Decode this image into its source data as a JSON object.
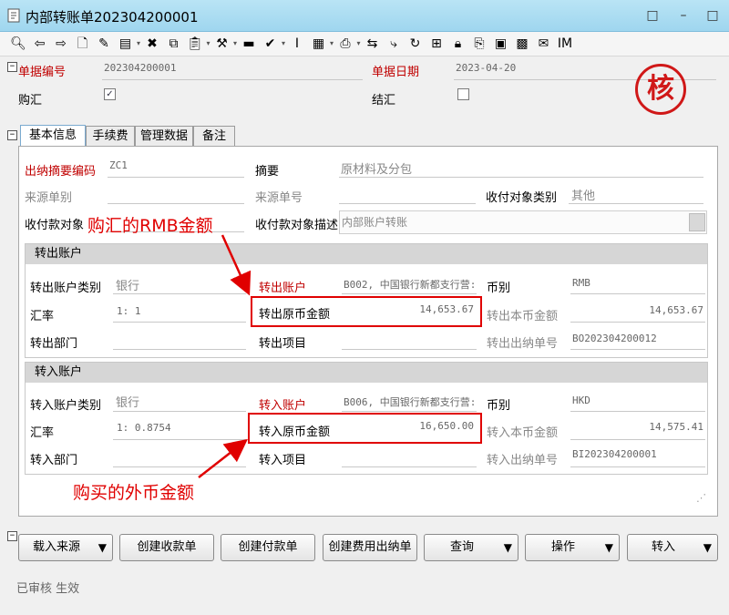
{
  "window": {
    "title": "内部转账单202304200001",
    "pin": "□",
    "minimize": "–",
    "maximize": "□",
    "close": "×"
  },
  "toolbar": [
    {
      "name": "preview-icon",
      "glyph": "🔍︎"
    },
    {
      "name": "arrow-left-icon",
      "glyph": "⇦"
    },
    {
      "name": "arrow-right-icon",
      "glyph": "⇨"
    },
    {
      "name": "new-document-icon",
      "glyph": "🗋"
    },
    {
      "name": "edit-icon",
      "glyph": "✎"
    },
    {
      "name": "save-icon",
      "glyph": "▤"
    },
    {
      "name": "delete-icon",
      "glyph": "✖"
    },
    {
      "name": "copy-icon",
      "glyph": "⧉"
    },
    {
      "name": "paste-icon",
      "glyph": "📋︎"
    },
    {
      "name": "tools-icon",
      "glyph": "⚒"
    },
    {
      "name": "red-doc-icon",
      "glyph": "▬"
    },
    {
      "name": "approve-icon",
      "glyph": "✔"
    },
    {
      "name": "unapprove-icon",
      "glyph": "Ⅰ"
    },
    {
      "name": "chart-icon",
      "glyph": "▦"
    },
    {
      "name": "print-icon",
      "glyph": "⎙"
    },
    {
      "name": "link-icon",
      "glyph": "⇆"
    },
    {
      "name": "flow-icon",
      "glyph": "⤷"
    },
    {
      "name": "refresh-icon",
      "glyph": "↻"
    },
    {
      "name": "tree-icon",
      "glyph": "⊞"
    },
    {
      "name": "lock-icon",
      "glyph": "🔒︎"
    },
    {
      "name": "attach-icon",
      "glyph": "⎘"
    },
    {
      "name": "calculator-icon",
      "glyph": "▣"
    },
    {
      "name": "export-icon",
      "glyph": "▩"
    },
    {
      "name": "mail-icon",
      "glyph": "✉"
    },
    {
      "name": "im-icon",
      "glyph": "IM"
    }
  ],
  "header": {
    "bill_no_label": "单据编号",
    "bill_no": "202304200001",
    "bill_date_label": "单据日期",
    "bill_date": "2023-04-20",
    "purchase_fx_label": "购汇",
    "purchase_fx_checked": "✓",
    "settle_fx_label": "结汇",
    "settle_fx_checked": "",
    "stamp": "核"
  },
  "tabs": [
    "基本信息",
    "手续费",
    "管理数据",
    "备注"
  ],
  "basic": {
    "summary_code_label": "出纳摘要编码",
    "summary_code": "ZC1",
    "summary_label": "摘要",
    "summary": "原材料及分包",
    "source_bill_label": "来源单别",
    "source_bill": "",
    "source_no_label": "来源单号",
    "source_no": "",
    "counterparty_type_label": "收付对象类别",
    "counterparty_type": "其他",
    "counterparty_label": "收付款对象",
    "counterparty": "",
    "counterparty_desc_label": "收付款对象描述",
    "counterparty_desc": "内部账户转账"
  },
  "out_account": {
    "title": "转出账户",
    "type_label": "转出账户类别",
    "type": "银行",
    "account_label": "转出账户",
    "account": "B002, 中国银行新都支行营:",
    "currency_label": "币别",
    "currency": "RMB",
    "rate_label": "汇率",
    "rate": "1: 1",
    "orig_amount_label": "转出原币金额",
    "orig_amount": "14,653.67",
    "local_amount_label": "转出本币金额",
    "local_amount": "14,653.67",
    "dept_label": "转出部门",
    "dept": "",
    "project_label": "转出项目",
    "project": "",
    "cashier_no_label": "转出出纳单号",
    "cashier_no": "BO202304200012"
  },
  "in_account": {
    "title": "转入账户",
    "type_label": "转入账户类别",
    "type": "银行",
    "account_label": "转入账户",
    "account": "B006, 中国银行新都支行营:",
    "currency_label": "币别",
    "currency": "HKD",
    "rate_label": "汇率",
    "rate": "1: 0.8754",
    "orig_amount_label": "转入原币金额",
    "orig_amount": "16,650.00",
    "local_amount_label": "转入本币金额",
    "local_amount": "14,575.41",
    "dept_label": "转入部门",
    "dept": "",
    "project_label": "转入项目",
    "project": "",
    "cashier_no_label": "转入出纳单号",
    "cashier_no": "BI202304200001"
  },
  "annotations": {
    "rmb": "购汇的RMB金额",
    "fx": "购买的外币金额"
  },
  "buttons": {
    "load_source": "载入来源",
    "create_receipt": "创建收款单",
    "create_payment": "创建付款单",
    "create_expense": "创建费用出纳单",
    "query": "查询",
    "operate": "操作",
    "transfer_in": "转入",
    "dropdown": "▼"
  },
  "status": "已审核 生效",
  "colors": {
    "titlebar": "#a8dcf2",
    "required_label": "#c00000",
    "annotation": "#e00000"
  }
}
